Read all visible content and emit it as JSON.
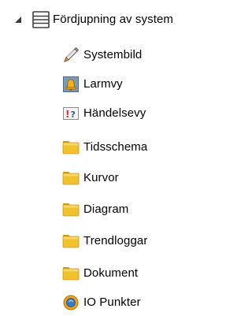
{
  "tree": {
    "root": {
      "label": "Fördjupning av system",
      "expanded": true,
      "icon": "system-list-icon"
    },
    "children": [
      {
        "label": "Systembild",
        "icon": "pencil-icon"
      },
      {
        "label": "Larmvy",
        "icon": "alarm-bell-icon"
      },
      {
        "label": "Händelsevy",
        "icon": "event-icon"
      },
      {
        "label": "Tidsschema",
        "icon": "folder-icon"
      },
      {
        "label": "Kurvor",
        "icon": "folder-icon"
      },
      {
        "label": "Diagram",
        "icon": "folder-icon"
      },
      {
        "label": "Trendloggar",
        "icon": "folder-icon"
      },
      {
        "label": "Dokument",
        "icon": "folder-icon"
      },
      {
        "label": "IO Punkter",
        "icon": "io-points-icon"
      }
    ]
  },
  "colors": {
    "folder": "#F2C12E",
    "folder_dark": "#C99A12",
    "alarm_bg": "#7E99B8",
    "alarm_bell": "#F3B21B",
    "event_red": "#D92B2B",
    "event_blue": "#2F5FA8",
    "io_orange": "#F2A51A",
    "io_blue": "#3A7BC8"
  }
}
